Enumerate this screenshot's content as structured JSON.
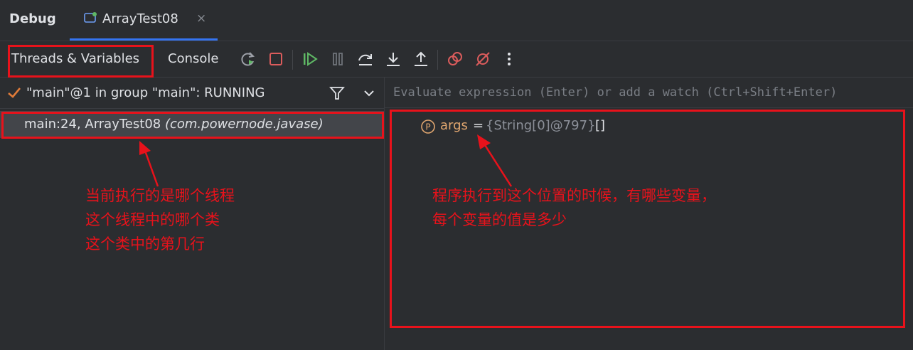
{
  "tabbar": {
    "debug_label": "Debug",
    "file_tab_label": "ArrayTest08",
    "close_glyph": "×"
  },
  "toolbar": {
    "threads_tab": "Threads & Variables",
    "console_tab": "Console",
    "icons": [
      "rerun-icon",
      "stop-icon",
      "resume-icon",
      "pause-icon",
      "step-over-icon",
      "step-into-icon",
      "step-out-icon",
      "view-breakpoints-icon",
      "mute-breakpoints-icon",
      "more-icon"
    ]
  },
  "threads": {
    "header": "\"main\"@1 in group \"main\": RUNNING",
    "frame_main": "main:24, ArrayTest08 ",
    "frame_package": "(com.powernode.javase)"
  },
  "variables": {
    "watch_placeholder": "Evaluate expression (Enter) or add a watch (Ctrl+Shift+Enter)",
    "var_name": "args",
    "var_eq": "=",
    "var_type": "{String[0]@797}",
    "var_value": "[]"
  },
  "annotations": {
    "left_note_lines": [
      "当前执行的是哪个线程",
      "这个线程中的哪个类",
      "这个类中的第几行"
    ],
    "right_note_lines": [
      "程序执行到这个位置的时候，有哪些变量，",
      "每个变量的值是多少"
    ]
  },
  "colors": {
    "annotation_red": "#e8121b",
    "accent_blue": "#3574f0",
    "resume_green": "#5fb865",
    "stop_red": "#db5c5c",
    "variable_orange": "#e0a66f"
  }
}
